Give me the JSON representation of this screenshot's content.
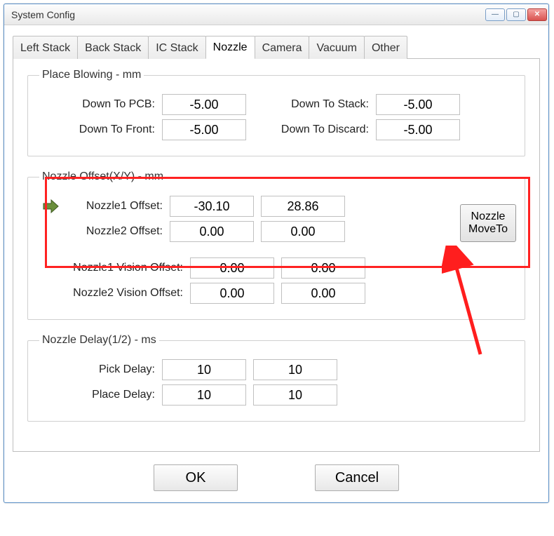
{
  "window": {
    "title": "System Config"
  },
  "tabs": [
    {
      "label": "Left Stack",
      "active": false
    },
    {
      "label": "Back Stack",
      "active": false
    },
    {
      "label": "IC Stack",
      "active": false
    },
    {
      "label": "Nozzle",
      "active": true
    },
    {
      "label": "Camera",
      "active": false
    },
    {
      "label": "Vacuum",
      "active": false
    },
    {
      "label": "Other",
      "active": false
    }
  ],
  "place_blowing": {
    "legend": "Place Blowing - mm",
    "down_to_pcb_label": "Down To PCB:",
    "down_to_pcb": "-5.00",
    "down_to_stack_label": "Down To Stack:",
    "down_to_stack": "-5.00",
    "down_to_front_label": "Down To Front:",
    "down_to_front": "-5.00",
    "down_to_discard_label": "Down To Discard:",
    "down_to_discard": "-5.00"
  },
  "nozzle_offset": {
    "legend": "Nozzle Offset(X/Y) - mm",
    "n1_label": "Nozzle1 Offset:",
    "n1_x": "-30.10",
    "n1_y": "28.86",
    "n2_label": "Nozzle2 Offset:",
    "n2_x": "0.00",
    "n2_y": "0.00",
    "moveto_label": "Nozzle MoveTo",
    "v1_label": "Nozzle1 Vision Offset:",
    "v1_x": "0.00",
    "v1_y": "0.00",
    "v2_label": "Nozzle2 Vision Offset:",
    "v2_x": "0.00",
    "v2_y": "0.00"
  },
  "nozzle_delay": {
    "legend": "Nozzle Delay(1/2) - ms",
    "pick_label": "Pick Delay:",
    "pick_1": "10",
    "pick_2": "10",
    "place_label": "Place Delay:",
    "place_1": "10",
    "place_2": "10"
  },
  "buttons": {
    "ok": "OK",
    "cancel": "Cancel"
  },
  "icons": {
    "minimize": "—",
    "maximize": "▢",
    "close": "✕"
  }
}
